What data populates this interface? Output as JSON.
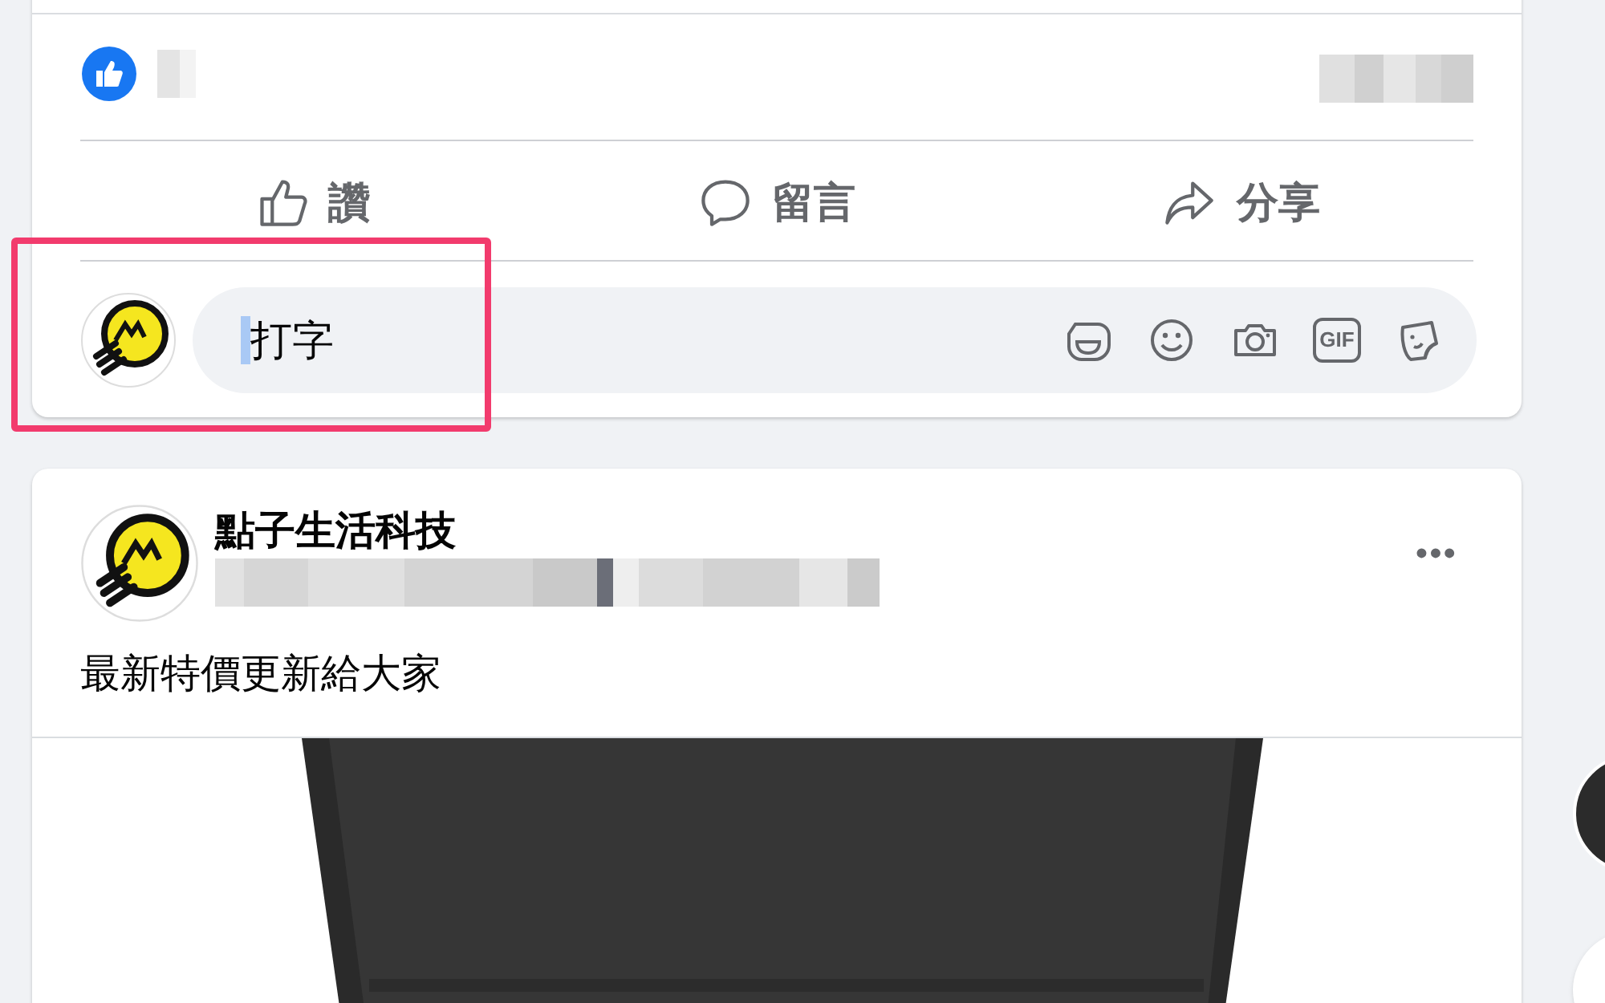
{
  "actions": [
    {
      "kind": "like",
      "label": "讚"
    },
    {
      "kind": "comment",
      "label": "留言"
    },
    {
      "kind": "share",
      "label": "分享"
    }
  ],
  "comment_box": {
    "value": "打字",
    "tools": [
      {
        "kind": "avatar"
      },
      {
        "kind": "emoji"
      },
      {
        "kind": "camera"
      },
      {
        "kind": "gif",
        "label": "GIF"
      },
      {
        "kind": "sticker"
      }
    ]
  },
  "post": {
    "author": "點子生活科技",
    "menu": "•••",
    "text": "最新特價更新給大家"
  }
}
